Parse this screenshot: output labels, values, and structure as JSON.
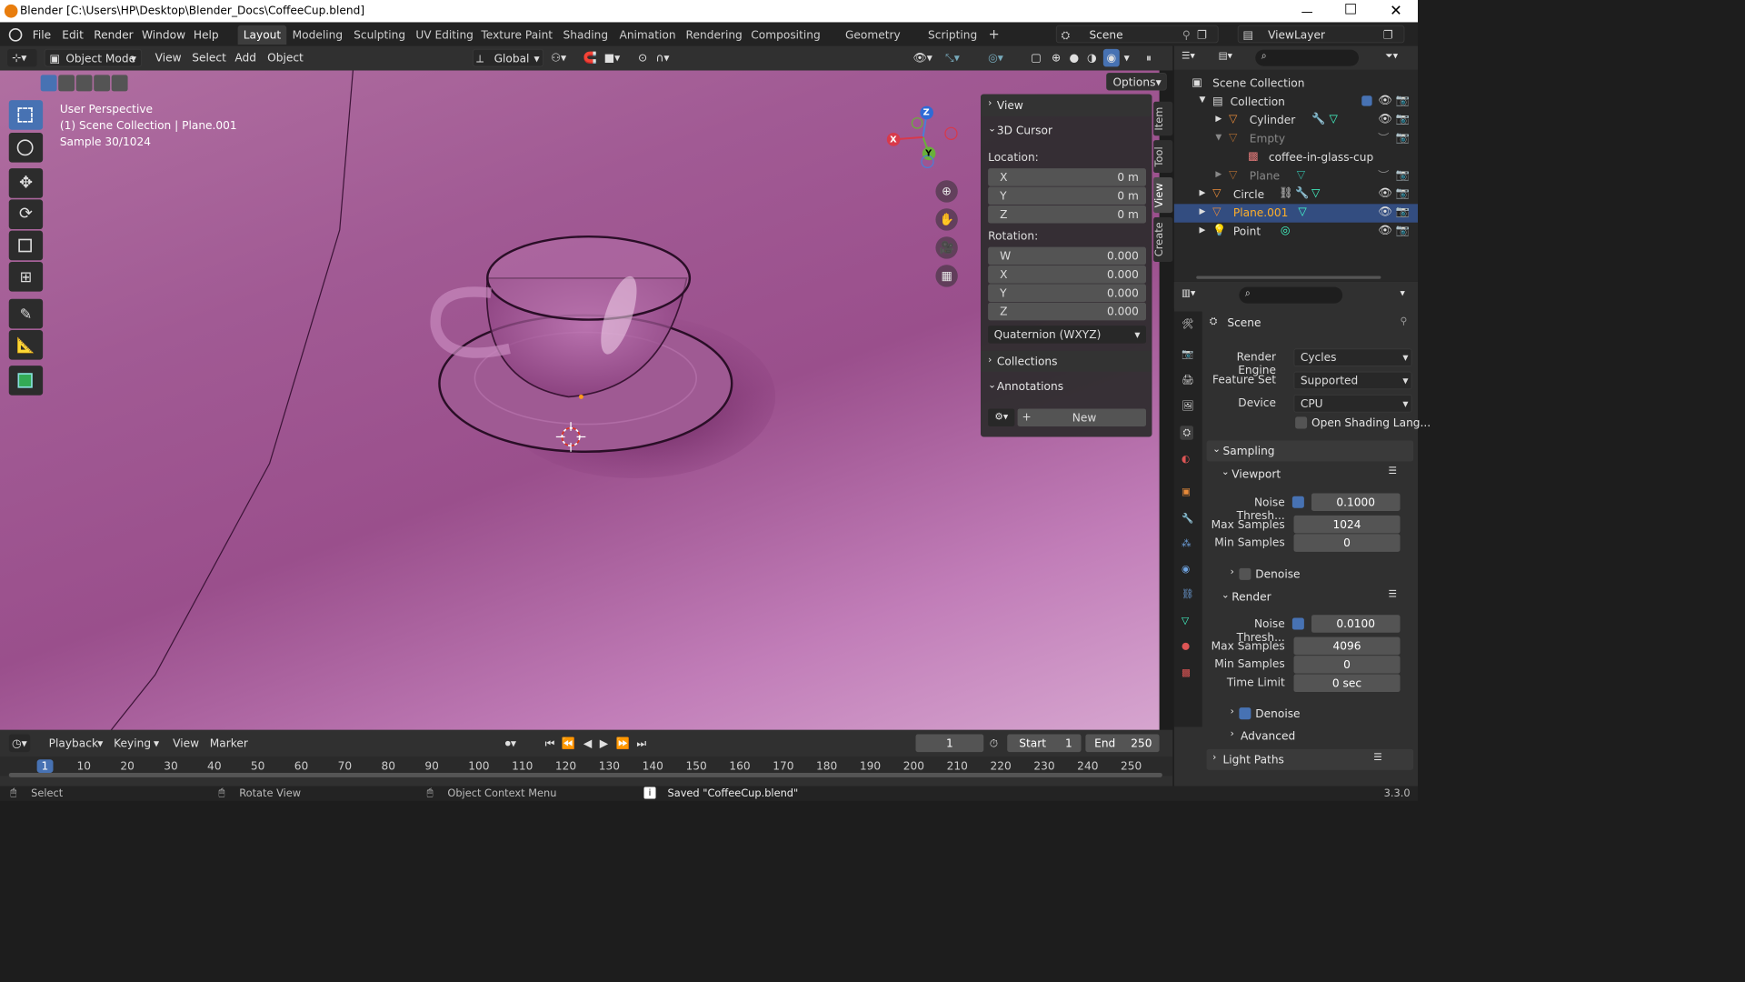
{
  "window": {
    "title": "Blender [C:\\Users\\HP\\Desktop\\Blender_Docs\\CoffeeCup.blend]",
    "controls": [
      "minimize-icon",
      "maximize-icon",
      "close-icon"
    ]
  },
  "menu": {
    "items": [
      "File",
      "Edit",
      "Render",
      "Window",
      "Help"
    ]
  },
  "workspaces": {
    "tabs": [
      "Layout",
      "Modeling",
      "Sculpting",
      "UV Editing",
      "Texture Paint",
      "Shading",
      "Animation",
      "Rendering",
      "Compositing",
      "Geometry Nodes",
      "Scripting"
    ],
    "active": "Layout",
    "add": "+"
  },
  "scene": {
    "name": "Scene",
    "view_layer": "ViewLayer"
  },
  "header": {
    "mode": "Object Mode",
    "view": "View",
    "select": "Select",
    "add": "Add",
    "object": "Object",
    "orientation": "Global",
    "options": "Options"
  },
  "viewport": {
    "perspective": "User Perspective",
    "collection": "(1) Scene Collection | Plane.001",
    "sample": "Sample 30/1024",
    "background_color": "#a9609b"
  },
  "gizmo": {
    "x": "X",
    "y": "Y",
    "z": "Z"
  },
  "npanel": {
    "view": "View",
    "cursor": "3D Cursor",
    "location_label": "Location:",
    "location": [
      {
        "axis": "X",
        "value": "0 m"
      },
      {
        "axis": "Y",
        "value": "0 m"
      },
      {
        "axis": "Z",
        "value": "0 m"
      }
    ],
    "rotation_label": "Rotation:",
    "rotation": [
      {
        "axis": "W",
        "value": "0.000"
      },
      {
        "axis": "X",
        "value": "0.000"
      },
      {
        "axis": "Y",
        "value": "0.000"
      },
      {
        "axis": "Z",
        "value": "0.000"
      }
    ],
    "rotation_mode": "Quaternion (WXYZ)",
    "collections": "Collections",
    "annotations": "Annotations",
    "new": "New",
    "tabs": [
      "Item",
      "Tool",
      "View",
      "Create"
    ]
  },
  "outliner": {
    "root": "Scene Collection",
    "items": [
      {
        "name": "Collection",
        "depth": 1
      },
      {
        "name": "Cylinder",
        "depth": 2
      },
      {
        "name": "Empty",
        "depth": 2
      },
      {
        "name": "coffee-in-glass-cup",
        "depth": 3
      },
      {
        "name": "Plane",
        "depth": 2
      },
      {
        "name": "Circle",
        "depth": 1
      },
      {
        "name": "Plane.001",
        "depth": 1
      },
      {
        "name": "Point",
        "depth": 1
      }
    ]
  },
  "properties": {
    "context": "Scene",
    "render_engine_label": "Render Engine",
    "render_engine": "Cycles",
    "feature_set_label": "Feature Set",
    "feature_set": "Supported",
    "device_label": "Device",
    "device": "CPU",
    "osl": "Open Shading Lang...",
    "sampling": "Sampling",
    "viewport": "Viewport",
    "vp_noise_label": "Noise Thresh...",
    "vp_noise": "0.1000",
    "vp_max_label": "Max Samples",
    "vp_max": "1024",
    "vp_min_label": "Min Samples",
    "vp_min": "0",
    "denoise": "Denoise",
    "render": "Render",
    "r_noise_label": "Noise Thresh...",
    "r_noise": "0.0100",
    "r_max_label": "Max Samples",
    "r_max": "4096",
    "r_min_label": "Min Samples",
    "r_min": "0",
    "time_limit_label": "Time Limit",
    "time_limit": "0 sec",
    "r_denoise": "Denoise",
    "advanced": "Advanced",
    "light_paths": "Light Paths"
  },
  "timeline": {
    "playback": "Playback",
    "keying": "Keying",
    "view": "View",
    "marker": "Marker",
    "current_frame": "1",
    "start_label": "Start",
    "start": "1",
    "end_label": "End",
    "end": "250",
    "ticks": [
      "1",
      "10",
      "20",
      "30",
      "40",
      "50",
      "60",
      "70",
      "80",
      "90",
      "100",
      "110",
      "120",
      "130",
      "140",
      "150",
      "160",
      "170",
      "180",
      "190",
      "200",
      "210",
      "220",
      "230",
      "240",
      "250"
    ]
  },
  "status": {
    "select": "Select",
    "rotate": "Rotate View",
    "context": "Object Context Menu",
    "saved": "Saved \"CoffeeCup.blend\"",
    "version": "3.3.0"
  }
}
